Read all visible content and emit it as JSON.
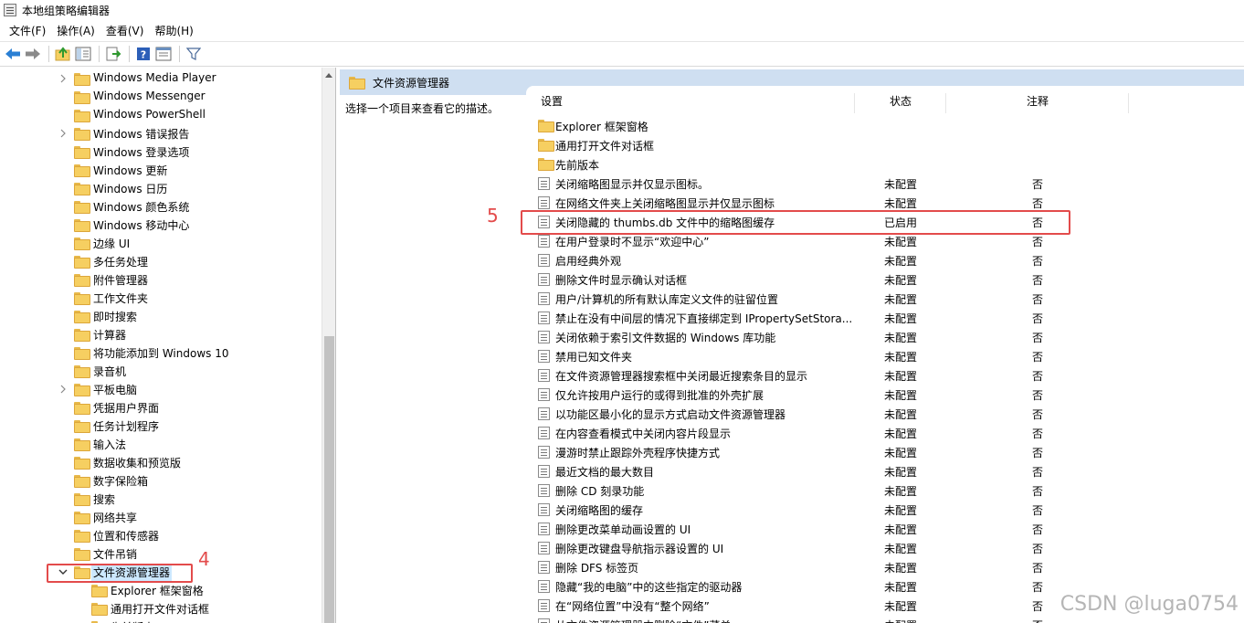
{
  "window": {
    "title": "本地组策略编辑器"
  },
  "menu": [
    "文件(F)",
    "操作(A)",
    "查看(V)",
    "帮助(H)"
  ],
  "toolbar_icons": [
    "back-icon",
    "forward-icon",
    "up-folder-icon",
    "show-hide-tree-icon",
    "export-list-icon",
    "help-icon",
    "properties-view-icon",
    "filter-icon"
  ],
  "tree": [
    {
      "label": "Windows Media Player",
      "expandable": true
    },
    {
      "label": "Windows Messenger",
      "expandable": false
    },
    {
      "label": "Windows PowerShell",
      "expandable": false
    },
    {
      "label": "Windows 错误报告",
      "expandable": true
    },
    {
      "label": "Windows 登录选项",
      "expandable": false
    },
    {
      "label": "Windows 更新",
      "expandable": false
    },
    {
      "label": "Windows 日历",
      "expandable": false
    },
    {
      "label": "Windows 颜色系统",
      "expandable": false
    },
    {
      "label": "Windows 移动中心",
      "expandable": false
    },
    {
      "label": "边缘 UI",
      "expandable": false
    },
    {
      "label": "多任务处理",
      "expandable": false
    },
    {
      "label": "附件管理器",
      "expandable": false
    },
    {
      "label": "工作文件夹",
      "expandable": false
    },
    {
      "label": "即时搜索",
      "expandable": false
    },
    {
      "label": "计算器",
      "expandable": false
    },
    {
      "label": "将功能添加到 Windows 10",
      "expandable": false
    },
    {
      "label": "录音机",
      "expandable": false
    },
    {
      "label": "平板电脑",
      "expandable": true
    },
    {
      "label": "凭据用户界面",
      "expandable": false
    },
    {
      "label": "任务计划程序",
      "expandable": false
    },
    {
      "label": "输入法",
      "expandable": false
    },
    {
      "label": "数据收集和预览版",
      "expandable": false
    },
    {
      "label": "数字保险箱",
      "expandable": false
    },
    {
      "label": "搜索",
      "expandable": false
    },
    {
      "label": "网络共享",
      "expandable": false
    },
    {
      "label": "位置和传感器",
      "expandable": false
    },
    {
      "label": "文件吊销",
      "expandable": false
    },
    {
      "label": "文件资源管理器",
      "expandable": true,
      "expanded": true,
      "selected": true
    },
    {
      "label": "Explorer 框架窗格",
      "child": true
    },
    {
      "label": "通用打开文件对话框",
      "child": true
    },
    {
      "label": "先前版本",
      "child": true
    }
  ],
  "right_header": {
    "title": "文件资源管理器"
  },
  "description": "选择一个项目来查看它的描述。",
  "columns": {
    "setting": "设置",
    "state": "状态",
    "comment": "注释"
  },
  "folders": [
    "Explorer 框架窗格",
    "通用打开文件对话框",
    "先前版本"
  ],
  "policies": [
    {
      "name": "关闭缩略图显示并仅显示图标。",
      "state": "未配置",
      "comment": "否"
    },
    {
      "name": "在网络文件夹上关闭缩略图显示并仅显示图标",
      "state": "未配置",
      "comment": "否"
    },
    {
      "name": "关闭隐藏的 thumbs.db 文件中的缩略图缓存",
      "state": "已启用",
      "comment": "否"
    },
    {
      "name": "在用户登录时不显示“欢迎中心”",
      "state": "未配置",
      "comment": "否"
    },
    {
      "name": "启用经典外观",
      "state": "未配置",
      "comment": "否"
    },
    {
      "name": "删除文件时显示确认对话框",
      "state": "未配置",
      "comment": "否"
    },
    {
      "name": "用户/计算机的所有默认库定义文件的驻留位置",
      "state": "未配置",
      "comment": "否"
    },
    {
      "name": "禁止在没有中间层的情况下直接绑定到 IPropertySetStora...",
      "state": "未配置",
      "comment": "否"
    },
    {
      "name": "关闭依赖于索引文件数据的 Windows 库功能",
      "state": "未配置",
      "comment": "否"
    },
    {
      "name": "禁用已知文件夹",
      "state": "未配置",
      "comment": "否"
    },
    {
      "name": "在文件资源管理器搜索框中关闭最近搜索条目的显示",
      "state": "未配置",
      "comment": "否"
    },
    {
      "name": "仅允许按用户运行的或得到批准的外壳扩展",
      "state": "未配置",
      "comment": "否"
    },
    {
      "name": "以功能区最小化的显示方式启动文件资源管理器",
      "state": "未配置",
      "comment": "否"
    },
    {
      "name": "在内容查看模式中关闭内容片段显示",
      "state": "未配置",
      "comment": "否"
    },
    {
      "name": "漫游时禁止跟踪外壳程序快捷方式",
      "state": "未配置",
      "comment": "否"
    },
    {
      "name": "最近文档的最大数目",
      "state": "未配置",
      "comment": "否"
    },
    {
      "name": "删除 CD 刻录功能",
      "state": "未配置",
      "comment": "否"
    },
    {
      "name": "关闭缩略图的缓存",
      "state": "未配置",
      "comment": "否"
    },
    {
      "name": "删除更改菜单动画设置的 UI",
      "state": "未配置",
      "comment": "否"
    },
    {
      "name": "删除更改键盘导航指示器设置的 UI",
      "state": "未配置",
      "comment": "否"
    },
    {
      "name": "删除 DFS 标签页",
      "state": "未配置",
      "comment": "否"
    },
    {
      "name": "隐藏“我的电脑”中的这些指定的驱动器",
      "state": "未配置",
      "comment": "否"
    },
    {
      "name": "在“网络位置”中没有“整个网络”",
      "state": "未配置",
      "comment": "否"
    },
    {
      "name": "从文件资源管理器中删除“文件”菜单",
      "state": "未配置",
      "comment": "否"
    }
  ],
  "annotations": {
    "left": "4",
    "right": "5"
  },
  "watermark": "CSDN @luga0754",
  "colors": {
    "header_bg": "#cfdff1",
    "highlight_red": "#e34b4b",
    "selection_bg": "#cce8ff",
    "folder": "#f6cf61"
  }
}
